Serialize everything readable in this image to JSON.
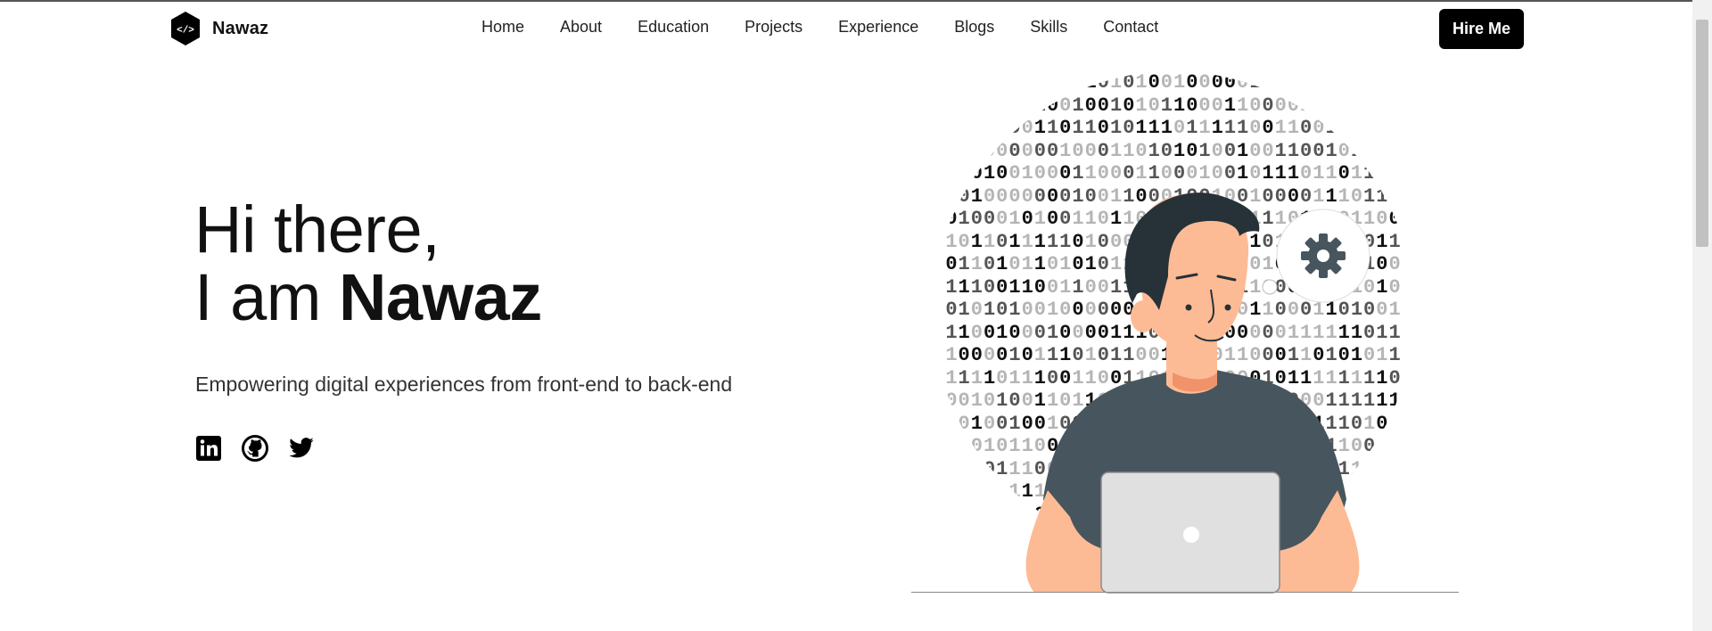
{
  "brand": {
    "name": "Nawaz",
    "logo_glyph": "</>"
  },
  "nav": {
    "items": [
      "Home",
      "About",
      "Education",
      "Projects",
      "Experience",
      "Blogs",
      "Skills",
      "Contact"
    ],
    "cta_label": "Hire Me"
  },
  "hero": {
    "greeting": "Hi there,",
    "intro": "I am",
    "name": "Nawaz",
    "tagline": "Empowering digital experiences from front-end to back-end"
  },
  "social": [
    {
      "icon": "linkedin-icon"
    },
    {
      "icon": "github-icon"
    },
    {
      "icon": "twitter-icon"
    }
  ],
  "colors": {
    "accent": "#000000",
    "skin": "#fdbb95",
    "shirt": "#47555f",
    "hair": "#263238",
    "laptop": "#e0e0e0"
  }
}
